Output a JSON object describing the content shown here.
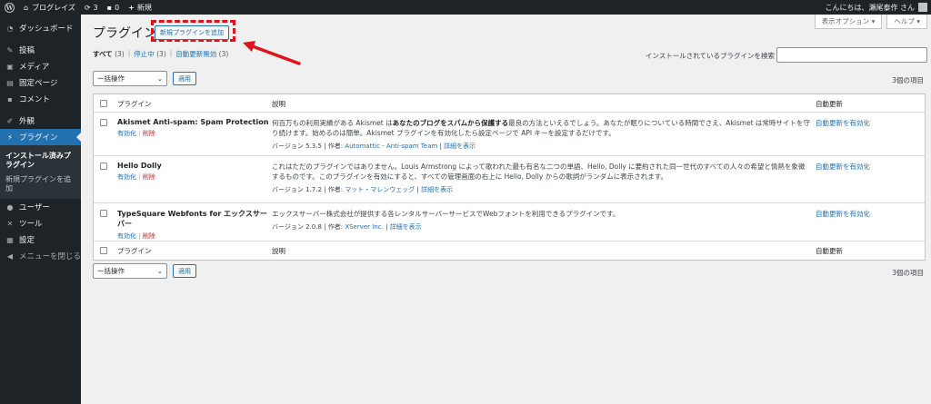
{
  "adminbar": {
    "site_name": "ブログレイズ",
    "updates_count": "3",
    "comments_count": "0",
    "new_label": "新規",
    "greeting": "こんにちは、瀬尾泰作 さん"
  },
  "sidebar": {
    "dashboard": "ダッシュボード",
    "posts": "投稿",
    "media": "メディア",
    "pages": "固定ページ",
    "comments": "コメント",
    "appearance": "外観",
    "plugins": "プラグイン",
    "sub_installed": "インストール済みプラグイン",
    "sub_add_new": "新規プラグインを追加",
    "users": "ユーザー",
    "tools": "ツール",
    "settings": "設定",
    "collapse": "メニューを閉じる"
  },
  "header": {
    "title": "プラグイン",
    "add_new": "新規プラグインを追加",
    "screen_options": "表示オプション ▾",
    "help": "ヘルプ ▾"
  },
  "filters": {
    "all": "すべて",
    "all_count": "(3)",
    "inactive": "停止中",
    "inactive_count": "(3)",
    "auto_disabled": "自動更新無効",
    "auto_disabled_count": "(3)",
    "sep": "|"
  },
  "search": {
    "label": "インストールされているプラグインを検索",
    "value": ""
  },
  "bulk": {
    "select_label": "一括操作",
    "apply_label": "適用",
    "items_count": "3個の項目"
  },
  "table": {
    "col_plugin": "プラグイン",
    "col_desc": "説明",
    "col_auto": "自動更新",
    "activate": "有効化",
    "delete": "削除",
    "enable_auto": "自動更新を有効化",
    "rows": [
      {
        "name": "Akismet Anti-spam: Spam Protection",
        "desc_pre": "何百万もの利用実績がある Akismet は",
        "desc_bold": "あなたのブログをスパムから保護する",
        "desc_post": "最良の方法といえるでしょう。あなたが眠りについている時間でさえ、Akismet は常時サイトを守り続けます。始めるのは簡単。Akismet プラグインを有効化したら設定ページで API キーを設定するだけです。",
        "version": "バージョン 5.3.5",
        "by": "作者:",
        "author": "Automattic - Anti-spam Team",
        "details": "詳細を表示"
      },
      {
        "name": "Hello Dolly",
        "desc_pre": "これはただのプラグインではありません。Louis Armstrong によって歌われた最も有名な二つの単語、Hello, Dolly に要約された同一世代のすべての人々の希望と情熱を象徴するものです。このプラグインを有効にすると、すべての管理画面の右上に Hello, Dolly からの歌詞がランダムに表示されます。",
        "desc_bold": "",
        "desc_post": "",
        "version": "バージョン 1.7.2",
        "by": "作者:",
        "author": "マット・マレンウェッグ",
        "details": "詳細を表示"
      },
      {
        "name": "TypeSquare Webfonts for エックスサーバー",
        "desc_pre": "エックスサーバー株式会社が提供する各レンタルサーバーサービスでWebフォントを利用できるプラグインです。",
        "desc_bold": "",
        "desc_post": "",
        "version": "バージョン 2.0.8",
        "by": "作者:",
        "author": "XServer Inc.",
        "details": "詳細を表示"
      }
    ]
  },
  "colors": {
    "accent": "#2271b1",
    "sidebar_bg": "#1d2327",
    "highlight": "#e0121a",
    "delete": "#b32d2e"
  }
}
